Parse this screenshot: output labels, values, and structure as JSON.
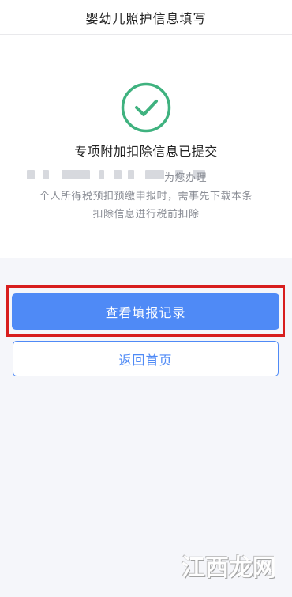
{
  "header": {
    "title": "婴幼儿照护信息填写"
  },
  "result": {
    "status_icon": "check-circle-icon",
    "title": "专项附加扣除信息已提交",
    "desc_line1": "为您办理",
    "desc_line2": "个人所得税预扣预缴申报时，需事先下载本条",
    "desc_line3": "扣除信息进行税前扣除"
  },
  "actions": {
    "view_records_label": "查看填报记录",
    "back_home_label": "返回首页"
  },
  "watermark": {
    "text": "江西龙网"
  },
  "colors": {
    "accent": "#4f8af6",
    "success": "#3fb27f",
    "highlight": "#d81e1e"
  }
}
